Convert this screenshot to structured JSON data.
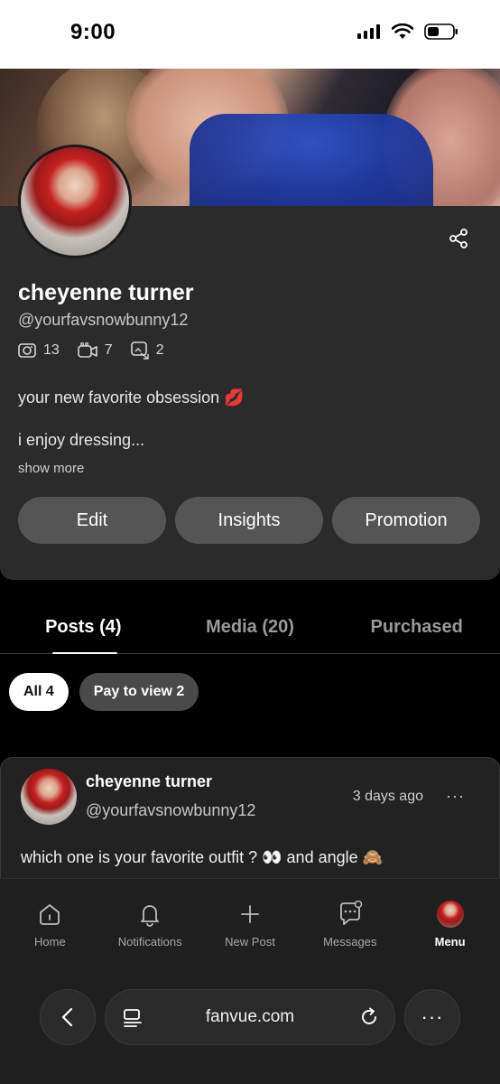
{
  "status_bar": {
    "time": "9:00"
  },
  "profile": {
    "display_name": "cheyenne turner",
    "handle": "@yourfavsnowbunny12",
    "stats": {
      "photos": "13",
      "videos": "7",
      "tagged": "2"
    },
    "bio_line1": "your new favorite obsession 💋",
    "bio_line2": "i enjoy dressing...",
    "show_more": "show more",
    "actions": {
      "edit": "Edit",
      "insights": "Insights",
      "promotion": "Promotion"
    }
  },
  "tabs": {
    "posts": "Posts (4)",
    "media": "Media (20)",
    "purchased": "Purchased"
  },
  "chips": {
    "all": "All 4",
    "pay": "Pay to view 2"
  },
  "post": {
    "name": "cheyenne turner",
    "handle": "@yourfavsnowbunny12",
    "time": "3 days ago",
    "more": "···",
    "text": "which one is your favorite outfit ? 👀 and angle 🙈"
  },
  "nav": {
    "home": "Home",
    "notifications": "Notifications",
    "new_post": "New Post",
    "messages": "Messages",
    "menu": "Menu"
  },
  "browser": {
    "url": "fanvue.com",
    "more": "···"
  }
}
